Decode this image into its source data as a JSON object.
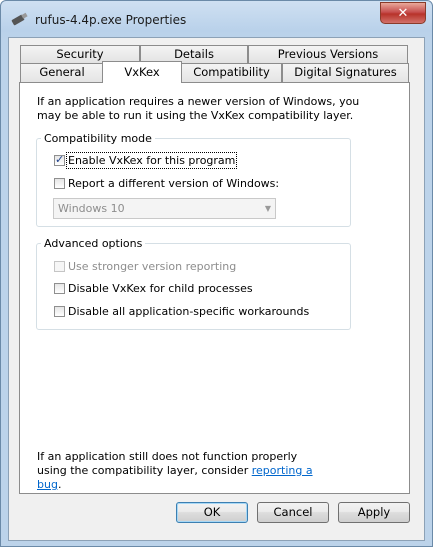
{
  "window": {
    "title": "rufus-4.4p.exe Properties",
    "close_glyph": "✕"
  },
  "tabs_row1": [
    "Security",
    "Details",
    "Previous Versions"
  ],
  "tabs_row2": [
    "General",
    "VxKex",
    "Compatibility",
    "Digital Signatures"
  ],
  "active_tab": "VxKex",
  "intro_text": "If an application requires a newer version of Windows, you may be able to run it using the VxKex compatibility layer.",
  "compat_group": {
    "label": "Compatibility mode",
    "enable_label": "Enable VxKex for this program",
    "enable_checked": true,
    "report_label": "Report a different version of Windows:",
    "report_checked": false,
    "version_value": "Windows 10"
  },
  "advanced_group": {
    "label": "Advanced options",
    "stronger_label": "Use stronger version reporting",
    "stronger_checked": false,
    "child_label": "Disable VxKex for child processes",
    "child_checked": false,
    "workarounds_label": "Disable all application-specific workarounds",
    "workarounds_checked": false
  },
  "footer_text": "If an application still does not function properly using the compatibility layer, consider",
  "footer_link": "reporting a bug",
  "footer_end": ".",
  "buttons": {
    "ok": "OK",
    "cancel": "Cancel",
    "apply": "Apply"
  }
}
